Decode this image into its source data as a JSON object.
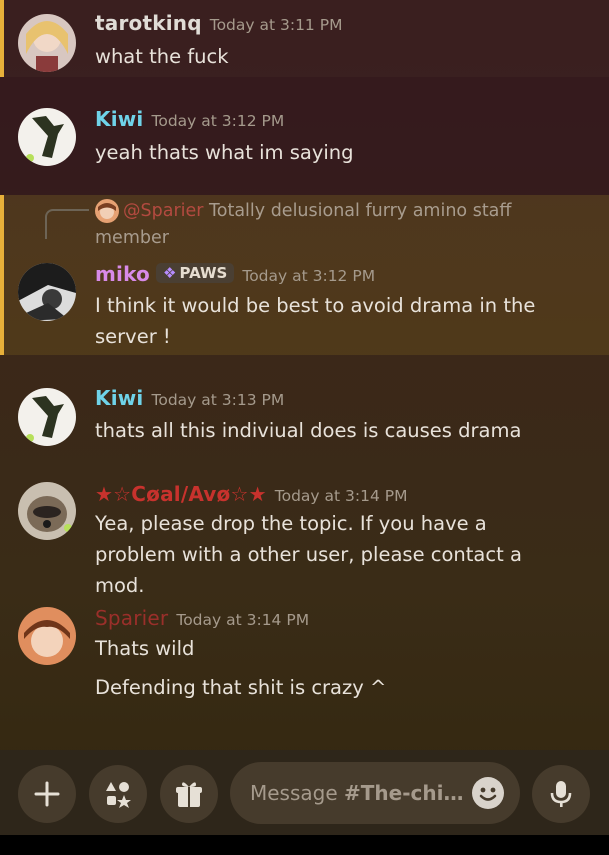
{
  "messages": [
    {
      "author": "tarotkinq",
      "time": "Today at 3:11 PM",
      "lines": [
        "what the fuck"
      ],
      "color": "#e0dcd6"
    },
    {
      "author": "Kiwi",
      "time": "Today at 3:12 PM",
      "lines": [
        "yeah thats what im saying"
      ],
      "color": "#6fd3e9"
    },
    {
      "reply_mention": "@Sparier",
      "reply_text": "Totally delusional furry amino staff member",
      "author": "miko",
      "tag": "PAWS",
      "time": "Today at 3:12 PM",
      "lines": [
        "I think it would be best to avoid drama in the server !"
      ],
      "color": "#d78ae8"
    },
    {
      "author": "Kiwi",
      "time": "Today at 3:13 PM",
      "lines": [
        "thats all this indiviual does is causes drama"
      ],
      "color": "#6fd3e9"
    },
    {
      "author": "★☆Cøal/Avø☆★",
      "time": "Today at 3:14 PM",
      "lines": [
        "Yea, please drop the topic. If you have a problem with a other user, please contact a mod."
      ],
      "color": "#c8322d"
    },
    {
      "author": "Sparier",
      "time": "Today at 3:14 PM",
      "lines": [
        "Thats wild",
        "Defending that shit is crazy ^"
      ],
      "color": "#9a2f2a"
    }
  ],
  "composer": {
    "placeholder_prefix": "Message ",
    "channel": "#The-chi…"
  },
  "icons": [
    "plus-icon",
    "apps-icon",
    "gift-icon",
    "emoji-icon",
    "microphone-icon"
  ]
}
